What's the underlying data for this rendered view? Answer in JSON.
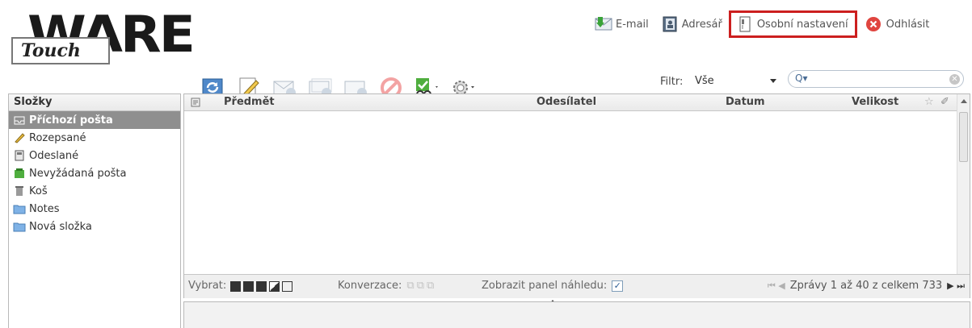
{
  "logo": {
    "main": "WARE",
    "tag": "Touch"
  },
  "toplinks": [
    {
      "label": "E-mail"
    },
    {
      "label": "Adresář"
    },
    {
      "label": "Osobní nastavení"
    },
    {
      "label": "Odhlásit"
    }
  ],
  "toolbar": {
    "icons": [
      "refresh-icon",
      "compose-icon",
      "reply-icon",
      "reply-all-icon",
      "forward-icon",
      "block-icon",
      "spam-check-icon",
      "settings-gear-icon"
    ]
  },
  "filter": {
    "label": "Filtr:",
    "value": "Vše"
  },
  "search": {
    "glyph": "Q▾",
    "placeholder": ""
  },
  "folders": {
    "header": "Složky",
    "items": [
      {
        "label": "Příchozí pošta",
        "icon": "inbox-icon",
        "active": true
      },
      {
        "label": "Rozepsané",
        "icon": "pencil-icon"
      },
      {
        "label": "Odeslané",
        "icon": "sent-icon"
      },
      {
        "label": "Nevyžádaná pošta",
        "icon": "junk-icon"
      },
      {
        "label": "Koš",
        "icon": "trash-icon"
      },
      {
        "label": "Notes",
        "icon": "folder-icon"
      },
      {
        "label": "Nová složka",
        "icon": "folder-icon"
      }
    ]
  },
  "grid": {
    "columns": {
      "subject": "Předmět",
      "sender": "Odesílatel",
      "date": "Datum",
      "size": "Velikost"
    },
    "rows": []
  },
  "statusbar": {
    "select_label": "Vybrat:",
    "conversation_label": "Konverzace:",
    "preview_label": "Zobrazit panel náhledu:",
    "preview_checked": true,
    "pager_text": "Zprávy 1 až 40 z celkem 733"
  },
  "colors": {
    "highlight": "#cc1f1f",
    "active_folder": "#8f8f8f"
  }
}
